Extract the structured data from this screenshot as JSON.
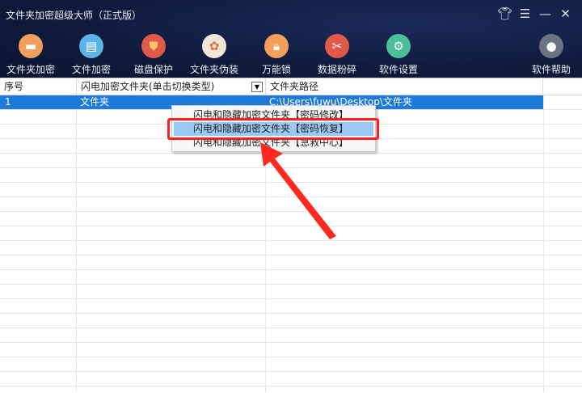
{
  "window": {
    "title": "文件夹加密超级大师（正式版）",
    "controls": [
      "skin",
      "menu",
      "minimize",
      "close"
    ]
  },
  "toolbar": [
    {
      "label": "文件夹加密",
      "icon": "folder-icon",
      "color": "#f0a05a"
    },
    {
      "label": "文件加密",
      "icon": "clipboard-icon",
      "color": "#5ab4e6"
    },
    {
      "label": "磁盘保护",
      "icon": "shield-icon",
      "color": "#e05a4a"
    },
    {
      "label": "文件夹伪装",
      "icon": "palette-icon",
      "color": "#efe6d8"
    },
    {
      "label": "万能锁",
      "icon": "lock-icon",
      "color": "#f0a05a"
    },
    {
      "label": "数据粉碎",
      "icon": "scissors-icon",
      "color": "#e05a4a"
    },
    {
      "label": "软件设置",
      "icon": "gear-icon",
      "color": "#4cbf9a"
    },
    {
      "label": "软件帮助",
      "icon": "user-icon",
      "color": "#6c7484"
    }
  ],
  "table": {
    "columns": [
      "序号",
      "闪电加密文件夹(单击切换类型)",
      "文件夹路径"
    ],
    "rows": [
      {
        "index": "1",
        "type": "文件夹",
        "path": "C:\\Users\\fuwu\\Desktop\\文件夹"
      }
    ]
  },
  "context_menu": {
    "items": [
      "闪电和隐藏加密文件夹【密码修改】",
      "闪电和隐藏加密文件夹【密码恢复】",
      "闪电和隐藏加密文件夹【急救中心】"
    ],
    "highlighted": 1
  },
  "colors": {
    "selection": "#1e7ad8",
    "highlight": "#ff1f1f"
  }
}
